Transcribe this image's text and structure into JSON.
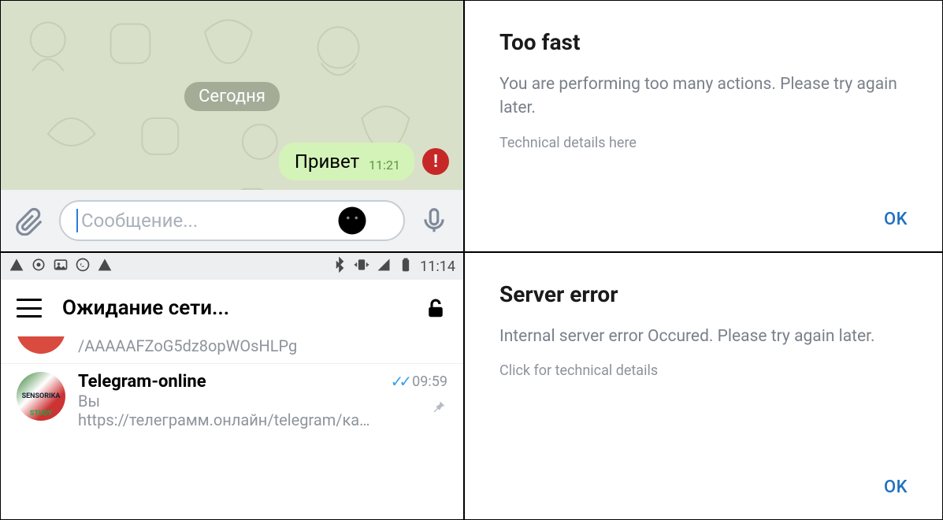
{
  "chat": {
    "date_chip": "Сегодня",
    "message": {
      "text": "Привет",
      "time": "11:21"
    },
    "error_badge_glyph": "!",
    "input_placeholder": "Сообщение..."
  },
  "statusbar": {
    "clock": "11:14"
  },
  "chatlist": {
    "title": "Ожидание сети...",
    "rows": [
      {
        "preview": "/AAAAAFZoG5dz8opWOsHLPg"
      },
      {
        "name": "Telegram-online",
        "sender": "Вы",
        "preview": "https://телеграмм.онлайн/telegram/ка…",
        "time": "09:59"
      }
    ]
  },
  "dialogs": {
    "too_fast": {
      "title": "Too fast",
      "body": "You are performing too many actions. Please try again later.",
      "tech": "Technical details here",
      "ok": "OK"
    },
    "server_error": {
      "title": "Server error",
      "body": "Internal server error Occured. Please try again later.",
      "tech": "Click for technical details",
      "ok": "OK"
    }
  }
}
